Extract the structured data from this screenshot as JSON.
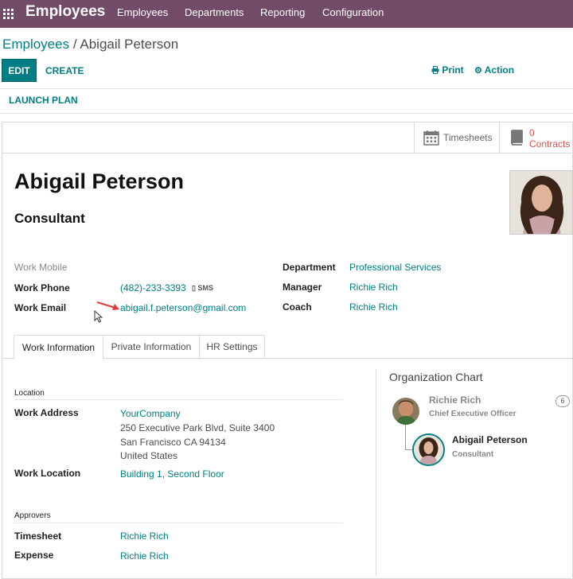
{
  "navbar": {
    "app_name": "Employees",
    "menu": [
      "Employees",
      "Departments",
      "Reporting",
      "Configuration"
    ],
    "icon": "apps-grid-icon",
    "color": "#714b67"
  },
  "breadcrumb": {
    "parent": "Employees",
    "separator": "/",
    "current": "Abigail Peterson"
  },
  "control_panel": {
    "edit": "EDIT",
    "create": "CREATE",
    "print": "Print",
    "action": "Action"
  },
  "header_buttons": {
    "launch_plan": "LAUNCH PLAN"
  },
  "stat_buttons": {
    "timesheets": "Timesheets",
    "contracts_count": "0",
    "contracts_label": "Contracts"
  },
  "employee": {
    "name": "Abigail Peterson",
    "job_title": "Consultant"
  },
  "contact": {
    "work_mobile_label": "Work Mobile",
    "work_phone_label": "Work Phone",
    "work_phone": "(482)-233-3393",
    "sms": "SMS",
    "work_email_label": "Work Email",
    "work_email": "abigail.f.peterson@gmail.com"
  },
  "org_fields": {
    "department_label": "Department",
    "department": "Professional Services",
    "manager_label": "Manager",
    "manager": "Richie Rich",
    "coach_label": "Coach",
    "coach": "Richie Rich"
  },
  "tabs": [
    "Work Information",
    "Private Information",
    "HR Settings"
  ],
  "work_info": {
    "location_section": "Location",
    "work_address_label": "Work Address",
    "company": "YourCompany",
    "address_line1": "250 Executive Park Blvd, Suite 3400",
    "address_line2": "San Francisco CA 94134",
    "address_line3": "United States",
    "work_location_label": "Work Location",
    "work_location": "Building 1, Second Floor",
    "approvers_section": "Approvers",
    "timesheet_label": "Timesheet",
    "timesheet_approver": "Richie Rich",
    "expense_label": "Expense",
    "expense_approver": "Richie Rich"
  },
  "org_chart": {
    "title": "Organization Chart",
    "manager_name": "Richie Rich",
    "manager_title": "Chief Executive Officer",
    "subordinates": "6",
    "employee_name": "Abigail Peterson",
    "employee_title": "Consultant"
  },
  "colors": {
    "accent": "#017e84",
    "contracts": "#d9534f"
  }
}
